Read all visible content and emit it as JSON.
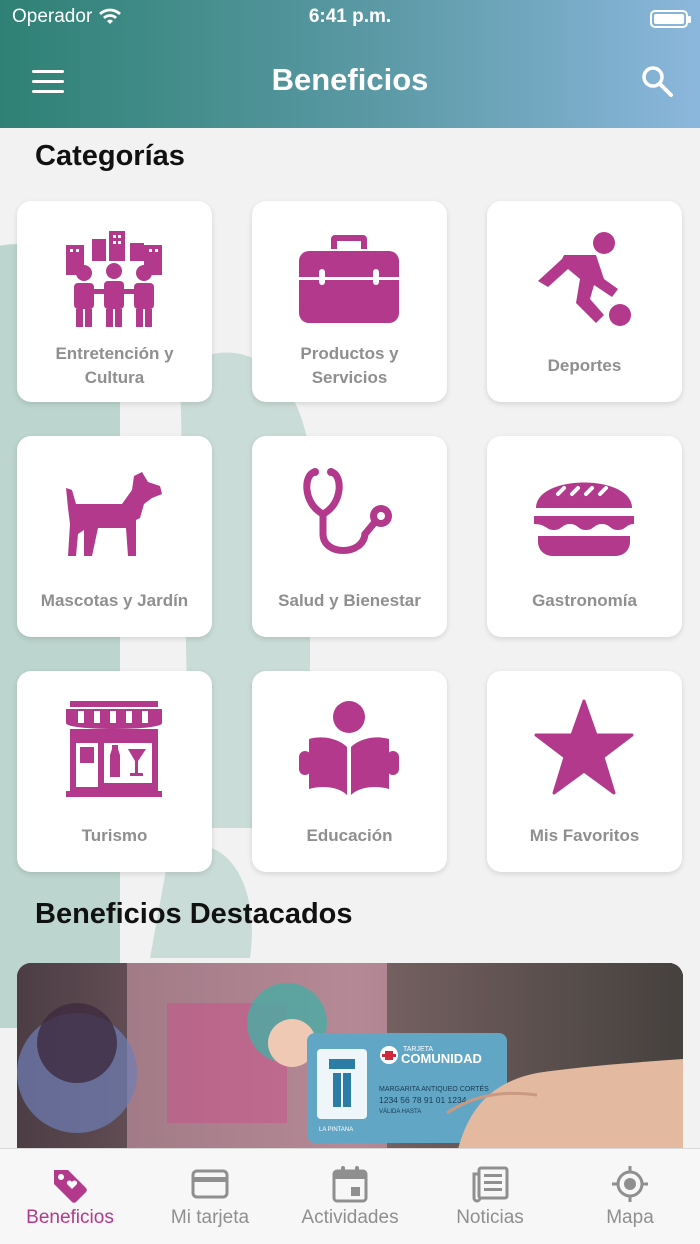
{
  "status_bar": {
    "carrier": "Operador",
    "time": "6:41 p.m."
  },
  "header": {
    "title": "Beneficios",
    "menu_icon": "menu-icon",
    "search_icon": "search-icon"
  },
  "categories_section": {
    "title": "Categorías"
  },
  "categories": [
    {
      "label": "Entretención y Cultura",
      "icon": "people-city-icon"
    },
    {
      "label": "Productos y Servicios",
      "icon": "briefcase-icon"
    },
    {
      "label": "Deportes",
      "icon": "soccer-player-icon"
    },
    {
      "label": "Mascotas y Jardín",
      "icon": "dog-icon"
    },
    {
      "label": "Salud y Bienestar",
      "icon": "stethoscope-icon"
    },
    {
      "label": "Gastronomía",
      "icon": "burger-icon"
    },
    {
      "label": "Turismo",
      "icon": "storefront-icon"
    },
    {
      "label": "Educación",
      "icon": "reader-icon"
    },
    {
      "label": "Mis Favoritos",
      "icon": "star-icon"
    }
  ],
  "featured_section": {
    "title": "Beneficios Destacados"
  },
  "featured_card": {
    "card_brand": "COMUNIDAD",
    "card_kicker": "TARJETA",
    "card_name": "MARGARITA ANTIQUEO CORTÉS",
    "card_number": "1234 56 78 91 01 1234",
    "card_valid": "VÁLIDA HASTA",
    "card_logo_text": "LA PINTANA"
  },
  "tab_bar": {
    "tabs": [
      {
        "label": "Beneficios",
        "icon": "tag-heart-icon",
        "active": true
      },
      {
        "label": "Mi tarjeta",
        "icon": "credit-card-icon",
        "active": false
      },
      {
        "label": "Actividades",
        "icon": "calendar-icon",
        "active": false
      },
      {
        "label": "Noticias",
        "icon": "newspaper-icon",
        "active": false
      },
      {
        "label": "Mapa",
        "icon": "location-target-icon",
        "active": false
      }
    ]
  },
  "colors": {
    "accent": "#b2398b",
    "header_start": "#2e8174",
    "header_end": "#8bb7dc",
    "muted_text": "#8f8f8f"
  }
}
